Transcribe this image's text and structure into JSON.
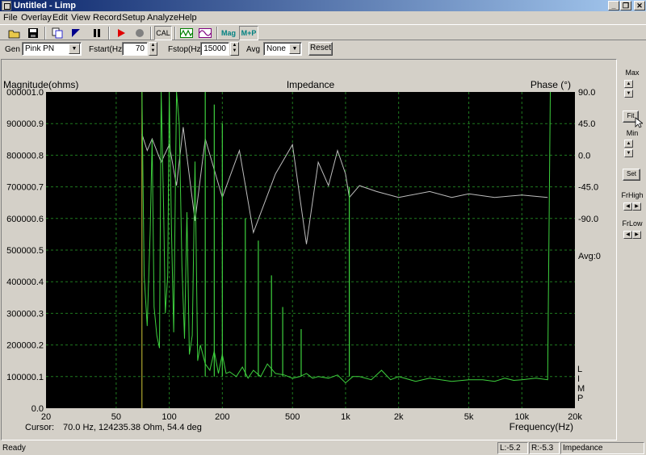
{
  "window": {
    "title": "Untitled - Limp",
    "minimize": "_",
    "maximize": "❐",
    "close": "✕"
  },
  "menu": [
    "File",
    "Overlay",
    "Edit",
    "View",
    "Record",
    "Setup",
    "Analyze",
    "Help"
  ],
  "toolbar": {
    "cal_label": "CAL",
    "mag_label": "Mag",
    "mp_label": "M+P",
    "colors": {
      "record": "#e00000",
      "stop": "#808080",
      "mag": "#008080"
    }
  },
  "gen_bar": {
    "gen_label": "Gen",
    "gen_value": "Pink PN",
    "fstart_label": "Fstart(Hz)",
    "fstart_value": "70",
    "fstop_label": "Fstop(Hz)",
    "fstop_value": "15000",
    "avg_label": "Avg",
    "avg_value": "None",
    "reset_label": "Reset"
  },
  "chart_data": {
    "type": "line",
    "title": "Impedance",
    "ylabel": "Magnitude(ohms)",
    "y2label": "Phase (°)",
    "xlabel": "Frequency(Hz)",
    "xscale": "log",
    "xlim": [
      20,
      20000
    ],
    "ylim": [
      0,
      1000001
    ],
    "y2lim": [
      -180,
      90
    ],
    "x_ticks": [
      "20",
      "50",
      "100",
      "200",
      "500",
      "1k",
      "2k",
      "5k",
      "10k",
      "20k"
    ],
    "y_ticks": [
      "000001.0",
      "900000.9",
      "800000.8",
      "700000.7",
      "600000.6",
      "500000.5",
      "400000.4",
      "300000.3",
      "200000.2",
      "100000.1",
      "0.0"
    ],
    "y2_ticks": [
      "90.0",
      "45.0",
      "0.0",
      "-45.0",
      "-90.0"
    ],
    "avg_label": "Avg:0",
    "watermark": [
      "L",
      "I",
      "M",
      "P"
    ],
    "cursor": {
      "label": "Cursor:",
      "text": "70.0 Hz, 124235.38 Ohm, 54.4 deg"
    },
    "colors": {
      "background": "#000000",
      "grid": "#1f7a1f",
      "magnitude": "#3ed13e",
      "phase": "#bdbdbd",
      "marker": "#d0c838"
    },
    "series": [
      {
        "name": "Magnitude",
        "x": [
          70,
          72,
          75,
          78,
          80,
          82,
          85,
          88,
          90,
          93,
          95,
          98,
          100,
          103,
          106,
          110,
          114,
          118,
          122,
          126,
          130,
          135,
          140,
          145,
          150,
          160,
          170,
          180,
          190,
          200,
          210,
          220,
          240,
          260,
          280,
          300,
          330,
          360,
          400,
          450,
          500,
          550,
          600,
          650,
          700,
          800,
          900,
          1000,
          1100,
          1200,
          1400,
          1600,
          1800,
          2000,
          2500,
          3000,
          4000,
          5000,
          6000,
          7000,
          8000,
          9000,
          10000,
          12000,
          14000,
          14500
        ],
        "values": [
          1000001,
          420000,
          260000,
          560000,
          850000,
          320000,
          230000,
          190000,
          1000001,
          620000,
          300000,
          420000,
          1000001,
          560000,
          240000,
          1000001,
          900000,
          450000,
          220000,
          620000,
          170000,
          230000,
          780000,
          150000,
          200000,
          140000,
          120000,
          180000,
          110000,
          170000,
          110000,
          115000,
          100000,
          130000,
          95000,
          120000,
          100000,
          140000,
          110000,
          105000,
          95000,
          100000,
          110000,
          95000,
          100000,
          95000,
          105000,
          80000,
          100000,
          100000,
          90000,
          120000,
          90000,
          100000,
          85000,
          95000,
          85000,
          90000,
          90000,
          85000,
          95000,
          88000,
          90000,
          95000,
          90000,
          1000001
        ]
      },
      {
        "name": "Phase",
        "x": [
          70,
          75,
          80,
          90,
          100,
          110,
          120,
          140,
          160,
          200,
          250,
          300,
          400,
          500,
          600,
          700,
          800,
          900,
          1000,
          1050,
          1200,
          1500,
          2000,
          3000,
          4000,
          5000,
          7000,
          10000,
          14000
        ],
        "values": [
          54,
          40,
          50,
          30,
          45,
          10,
          60,
          -20,
          50,
          0,
          40,
          -30,
          20,
          45,
          -40,
          30,
          10,
          40,
          20,
          0,
          10,
          5,
          0,
          5,
          0,
          3,
          0,
          2,
          0
        ]
      }
    ],
    "peak_spikes": [
      {
        "x": 160,
        "y": 1000001
      },
      {
        "x": 180,
        "y": 960000
      },
      {
        "x": 200,
        "y": 900000
      },
      {
        "x": 270,
        "y": 600000
      },
      {
        "x": 320,
        "y": 530000
      },
      {
        "x": 380,
        "y": 420000
      },
      {
        "x": 440,
        "y": 320000
      },
      {
        "x": 560,
        "y": 250000
      },
      {
        "x": 1050,
        "y": 700000
      }
    ]
  },
  "right_panel": {
    "max": "Max",
    "fit": "Fit",
    "min": "Min",
    "set": "Set",
    "frhigh": "FrHigh",
    "frlow": "FrLow"
  },
  "status": {
    "ready": "Ready",
    "l": "L:-5.2",
    "r": "R:-5.3",
    "mode": "Impedance Measurement"
  }
}
